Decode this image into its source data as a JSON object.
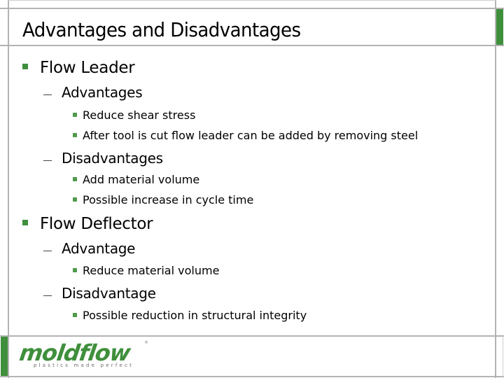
{
  "slide": {
    "title": "Advantages and Disadvantages",
    "accent_color": "#3f8f3c",
    "bullets": [
      {
        "label": "Flow Leader",
        "children": [
          {
            "label": "Advantages",
            "children": [
              "Reduce shear stress",
              "After tool is cut flow leader can be added by removing steel"
            ]
          },
          {
            "label": "Disadvantages",
            "children": [
              "Add material volume",
              "Possible increase in cycle time"
            ]
          }
        ]
      },
      {
        "label": "Flow Deflector",
        "children": [
          {
            "label": "Advantage",
            "children": [
              "Reduce material volume"
            ]
          },
          {
            "label": "Disadvantage",
            "children": [
              "Possible reduction in structural integrity"
            ]
          }
        ]
      }
    ]
  },
  "logo": {
    "name": "moldflow",
    "tagline": "plastics made perfect",
    "registered": "®"
  }
}
